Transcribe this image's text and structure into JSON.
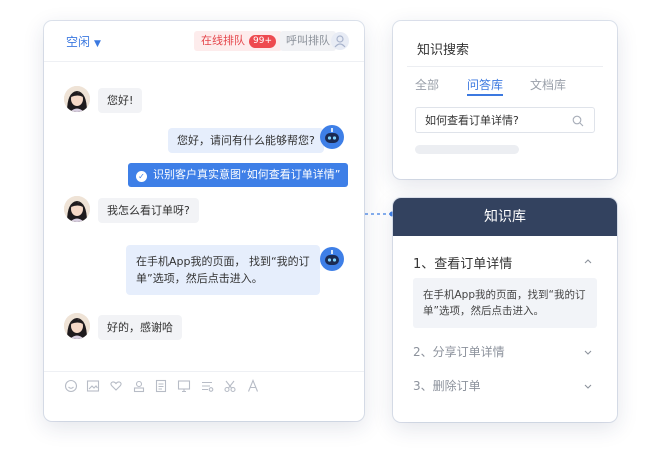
{
  "chat": {
    "status_label": "空闲",
    "queue_label": "在线排队",
    "queue_count": "99+",
    "call_queue_label": "呼叫排队",
    "messages": {
      "m1": "您好!",
      "m2": "您好，请问有什么能够帮您?",
      "intent": "识别客户真实意图“如何查看订单详情”",
      "m3": "我怎么看订单呀?",
      "m4_line1": "在手机App我的页面， 找到“我的订",
      "m4_line2": "单”选项，然后点击进入。",
      "m5": "好的，感谢哈"
    },
    "toolbar_icons": [
      "emoji-icon",
      "image-icon",
      "heart-hand-icon",
      "user-card-icon",
      "document-icon",
      "screen-icon",
      "list-icon",
      "scissors-icon",
      "font-icon"
    ]
  },
  "search": {
    "title": "知识搜索",
    "tabs": [
      "全部",
      "问答库",
      "文档库"
    ],
    "active_tab": "问答库",
    "query": "如何查看订单详情?"
  },
  "kb": {
    "title": "知识库",
    "items": [
      {
        "label": "1、查看订单详情",
        "expanded": true
      },
      {
        "label": "2、分享订单详情",
        "expanded": false
      },
      {
        "label": "3、删除订单",
        "expanded": false
      }
    ],
    "answer_line1": "在手机App我的页面，找到“我的订",
    "answer_line2": "单”选项，然后点击进入。"
  },
  "colors": {
    "accent": "#3e7fe7",
    "kb_header": "#33425f",
    "queue_red": "#ee4a4f"
  }
}
